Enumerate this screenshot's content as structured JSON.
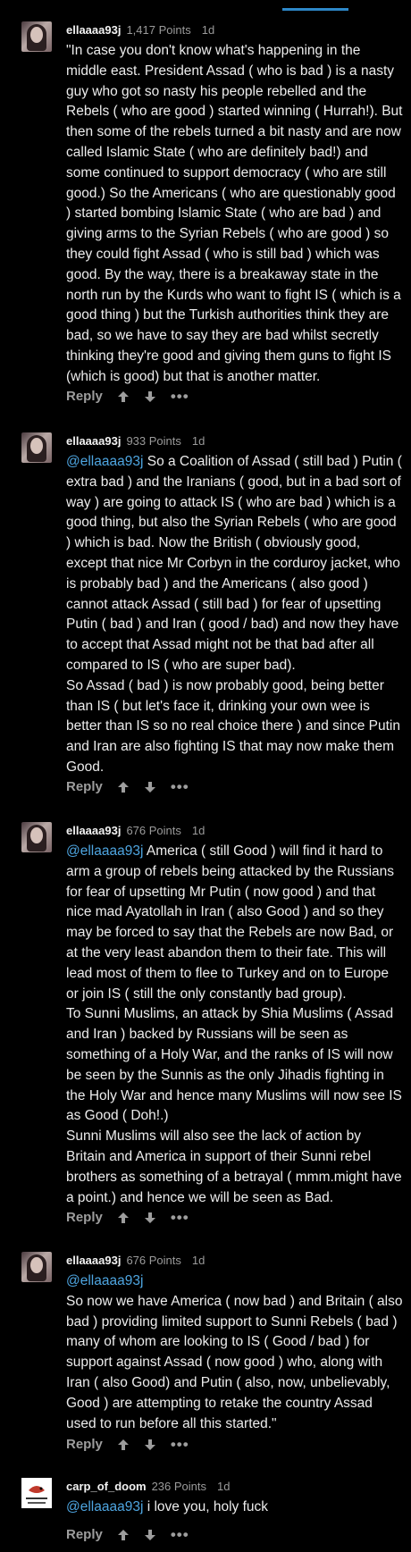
{
  "comments": [
    {
      "username": "ellaaaa93j",
      "points": "1,417 Points",
      "age": "1d",
      "mention": "",
      "paragraphs": [
        "\"In case you don't know what's happening in the middle east. President Assad ( who is bad ) is a nasty guy who got so nasty his people rebelled and the Rebels ( who are good ) started winning ( Hurrah!). But then some of the rebels turned a bit nasty and are now called Islamic State ( who are definitely bad!) and some continued to support democracy ( who are still good.) So the Americans ( who are questionably good ) started bombing Islamic State ( who are bad ) and giving arms to the Syrian Rebels ( who are good ) so they could fight Assad ( who is still bad ) which was good. By the way, there is a breakaway state in the north run by the Kurds who want to fight IS ( which is a good thing ) but the Turkish authorities think they are bad, so we have to say they are bad whilst secretly thinking they're good and giving them guns to fight IS (which is good) but that is another matter."
      ],
      "reply_label": "Reply"
    },
    {
      "username": "ellaaaa93j",
      "points": "933 Points",
      "age": "1d",
      "mention": "@ellaaaa93j",
      "paragraphs": [
        " So a Coalition of Assad ( still bad ) Putin ( extra bad ) and the Iranians ( good, but in a bad sort of way ) are going to attack IS ( who are bad ) which is a good thing, but also the Syrian Rebels ( who are good ) which is bad. Now the British ( obviously good, except that nice Mr Corbyn in the corduroy jacket, who is probably bad ) and the Americans ( also good ) cannot attack Assad ( still bad ) for fear of upsetting Putin ( bad ) and Iran ( good / bad) and now they have to accept that Assad might not be that bad after all compared to IS ( who are super bad).",
        "So Assad ( bad ) is now probably good, being better than IS ( but let's face it, drinking your own wee is better than IS so no real choice there ) and since Putin and Iran are also fighting IS that may now make them Good."
      ],
      "reply_label": "Reply"
    },
    {
      "username": "ellaaaa93j",
      "points": "676 Points",
      "age": "1d",
      "mention": "@ellaaaa93j",
      "paragraphs": [
        " America ( still Good ) will find it hard to arm a group of rebels being attacked by the Russians for fear of upsetting Mr Putin ( now good ) and that nice mad Ayatollah in Iran ( also Good ) and so they may be forced to say that the Rebels are now Bad, or at the very least abandon them to their fate. This will lead most of them to flee to Turkey and on to Europe or join IS ( still the only constantly bad group).",
        "To Sunni Muslims, an attack by Shia Muslims ( Assad and Iran ) backed by Russians will be seen as something of a Holy War, and the ranks of IS will now be seen by the Sunnis as the only Jihadis fighting in the Holy War and hence many Muslims will now see IS as Good ( Doh!.)",
        "Sunni Muslims will also see the lack of action by Britain and America in support of their Sunni rebel brothers as something of a betrayal ( mmm.might have a point.) and hence we will be seen as Bad."
      ],
      "reply_label": "Reply"
    },
    {
      "username": "ellaaaa93j",
      "points": "676 Points",
      "age": "1d",
      "mention": "@ellaaaa93j",
      "paragraphs": [
        "",
        "So now we have America ( now bad ) and Britain ( also bad ) providing limited support to Sunni Rebels ( bad ) many of whom are looking to IS ( Good / bad ) for support against Assad ( now good ) who, along with Iran ( also Good) and Putin ( also, now, unbelievably, Good ) are attempting to retake the country Assad used to run before all this started.\""
      ],
      "reply_label": "Reply"
    },
    {
      "username": "carp_of_doom",
      "points": "236 Points",
      "age": "1d",
      "mention": "@ellaaaa93j",
      "paragraphs": [
        " i love you, holy fuck"
      ],
      "reply_label": "Reply"
    }
  ],
  "colors": {
    "accent": "#2d88c9",
    "mention": "#4ea5e0",
    "background": "#000000"
  },
  "icons": [
    "upvote-icon",
    "downvote-icon",
    "more-options-icon"
  ]
}
